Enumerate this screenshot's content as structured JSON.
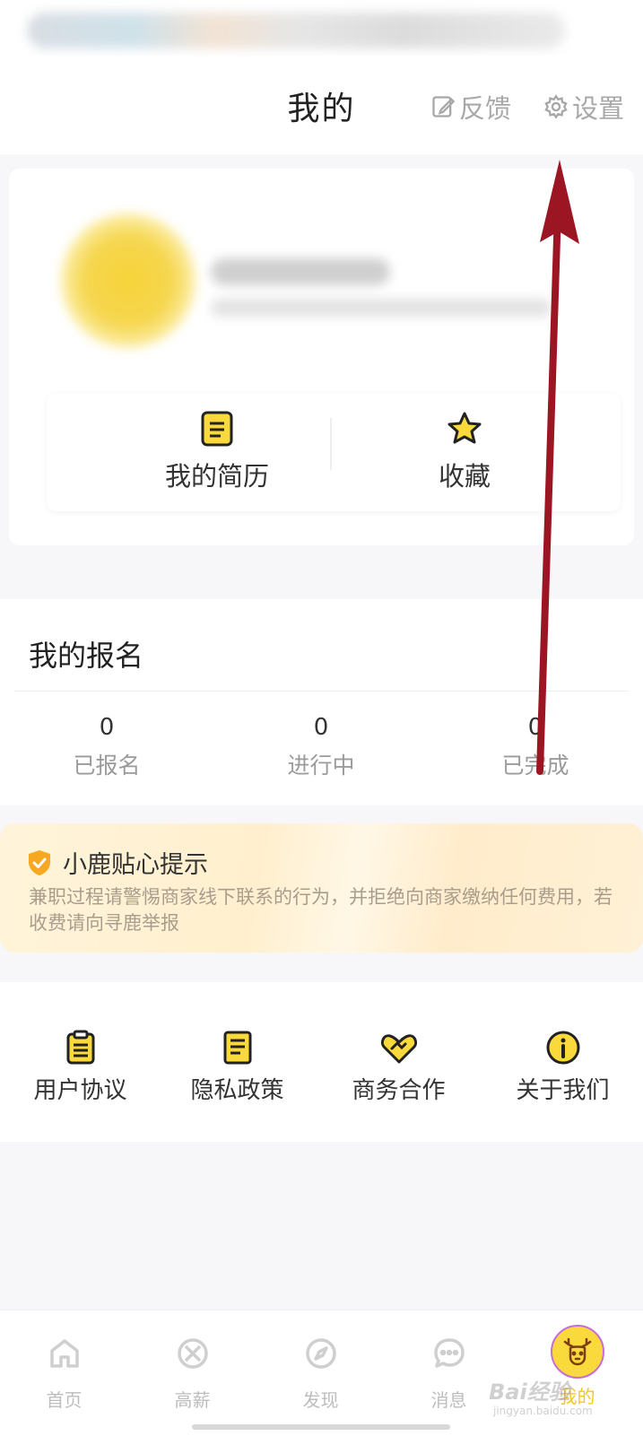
{
  "header": {
    "title": "我的",
    "feedback_label": "反馈",
    "settings_label": "设置"
  },
  "quick_actions": [
    {
      "label": "我的简历",
      "icon": "resume-icon"
    },
    {
      "label": "收藏",
      "icon": "star-icon"
    }
  ],
  "signup": {
    "title": "我的报名",
    "stats": [
      {
        "value": "0",
        "label": "已报名"
      },
      {
        "value": "0",
        "label": "进行中"
      },
      {
        "value": "0",
        "label": "已完成"
      }
    ]
  },
  "tip": {
    "title": "小鹿贴心提示",
    "body": "兼职过程请警惕商家线下联系的行为，并拒绝向商家缴纳任何费用，若收费请向寻鹿举报"
  },
  "links": [
    {
      "label": "用户协议",
      "icon": "clipboard-icon"
    },
    {
      "label": "隐私政策",
      "icon": "document-icon"
    },
    {
      "label": "商务合作",
      "icon": "handshake-icon"
    },
    {
      "label": "关于我们",
      "icon": "info-icon"
    }
  ],
  "tabs": [
    {
      "label": "首页",
      "icon": "home-icon"
    },
    {
      "label": "高薪",
      "icon": "high-salary-icon"
    },
    {
      "label": "发现",
      "icon": "compass-icon"
    },
    {
      "label": "消息",
      "icon": "message-icon"
    },
    {
      "label": "我的",
      "icon": "deer-icon",
      "active": true
    }
  ],
  "watermark": {
    "text": "Bai经验",
    "sub": "jingyan.baidu.com"
  },
  "colors": {
    "accent_yellow": "#f9d93b",
    "annotation_arrow": "#9b1622",
    "tip_background": "#fff0d2",
    "muted_text": "#a8a8a8"
  }
}
